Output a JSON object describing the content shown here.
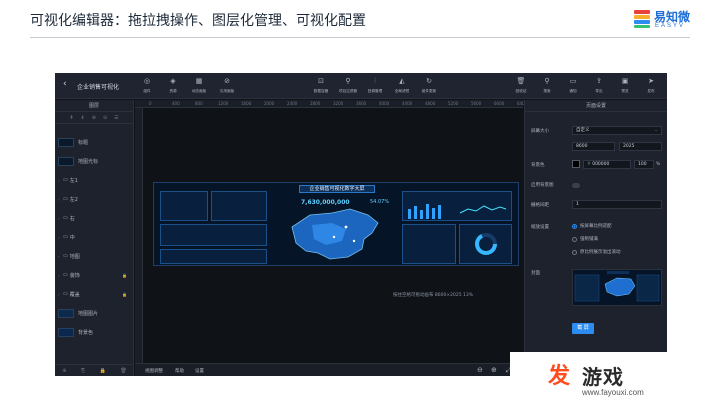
{
  "slide": {
    "title": "可视化编辑器：拖拉拽操作、图层化管理、可视化配置",
    "logo_cn": "易知微",
    "logo_en": "EASYV",
    "logo_colors": [
      "#e8423c",
      "#f6b02d",
      "#2d8cf0",
      "#36c275"
    ]
  },
  "topbar": {
    "back_icon": "chevron-left-icon",
    "project_name": "企业销售可视化",
    "left_tools": [
      "组件",
      "资源",
      "动态面板",
      "引用面板"
    ],
    "center_tools": [
      "数据容器",
      "项目过滤器",
      "回调管理",
      "全局滤镜",
      "组件更新"
    ],
    "right_tools": [
      "回收站",
      "搜索",
      "通知",
      "导出",
      "预览",
      "发布"
    ]
  },
  "layers_panel": {
    "title": "图层",
    "tools": [
      "⇞",
      "⇟",
      "⊕",
      "⊖",
      "☰"
    ],
    "items": [
      {
        "name": "标题",
        "type": "thumb"
      },
      {
        "name": "地图光标",
        "type": "thumb"
      },
      {
        "name": "左1",
        "type": "folder"
      },
      {
        "name": "左2",
        "type": "folder"
      },
      {
        "name": "右",
        "type": "folder"
      },
      {
        "name": "中",
        "type": "folder"
      },
      {
        "name": "地图",
        "type": "folder"
      },
      {
        "name": "装饰",
        "type": "folder",
        "locked": true
      },
      {
        "name": "覆盖",
        "type": "folder",
        "locked": true
      },
      {
        "name": "地图图片",
        "type": "thumb"
      },
      {
        "name": "背景色",
        "type": "thumb"
      }
    ]
  },
  "ruler": {
    "top_ticks": [
      "0",
      "400",
      "800",
      "1200",
      "1600",
      "2000",
      "2400",
      "2800",
      "3200",
      "3600",
      "4000",
      "4400",
      "4800",
      "5200",
      "5600",
      "6000",
      "6400"
    ]
  },
  "screen": {
    "title": "企业销售可视化数字大屏",
    "big_number": "7,630,000,000",
    "percent": "54.07%"
  },
  "canvas": {
    "status_text": "按住空格可拖动画布  8600×2025  13%",
    "footer_items": [
      "视图调整",
      "帮助",
      "设置"
    ]
  },
  "page_settings": {
    "title": "页面设置",
    "screen_size_label": "屏幕大小",
    "screen_size_value": "自定义",
    "width": "8600",
    "height": "2025",
    "bg_color_label": "背景色",
    "bg_color_value": "000000",
    "bg_opacity": "100",
    "opacity_unit": "%",
    "enable_bg_image_label": "启用背景图",
    "grid_size_label": "栅格间距",
    "grid_size_value": "1",
    "scale_label": "缩放设置",
    "scale_options": [
      "按屏幕比例适配",
      "强制铺满",
      "原比例展示溢出滚动"
    ],
    "scale_selected": 0,
    "cover_label": "封面",
    "cover_button": "截 屏"
  },
  "watermark": {
    "icon": "发",
    "text": "游戏",
    "url": "www.fayouxi.com"
  },
  "colors": {
    "accent": "#2d8cf0",
    "app_bg": "#101319",
    "panel_bg": "#1d222c",
    "screen_bg": "#061428"
  }
}
